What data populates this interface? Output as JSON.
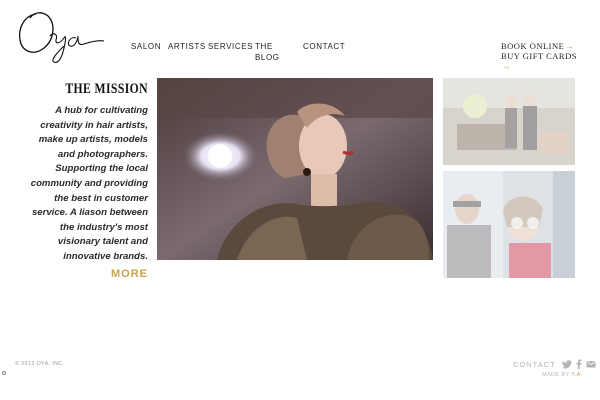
{
  "brand": {
    "logo_text": "Oya",
    "accent_color": "#c9a24a"
  },
  "nav": {
    "items": [
      {
        "label": "SALON"
      },
      {
        "label": "ARTISTS"
      },
      {
        "label": "SERVICES"
      },
      {
        "label": "THE BLOG"
      },
      {
        "label": "CONTACT"
      }
    ]
  },
  "top_links": {
    "book_online": "BOOK ONLINE",
    "gift_cards": "BUY GIFT CARDS",
    "arrow": "→"
  },
  "mission": {
    "title": "THE MISSION",
    "text": "A hub for cultivating creativity in hair artists, make up artists, models and photographers. Supporting the local community and providing the best in customer service. A liason between the industry's most visionary talent and innovative brands.",
    "more": "MORE"
  },
  "footer": {
    "copyright": "© 2013 OYA, INC.",
    "contact": "CONTACT",
    "social_icons": [
      "twitter-icon",
      "facebook-icon",
      "email-icon"
    ],
    "made_by_prefix": "MADE BY",
    "made_by_name": "Y.A"
  }
}
